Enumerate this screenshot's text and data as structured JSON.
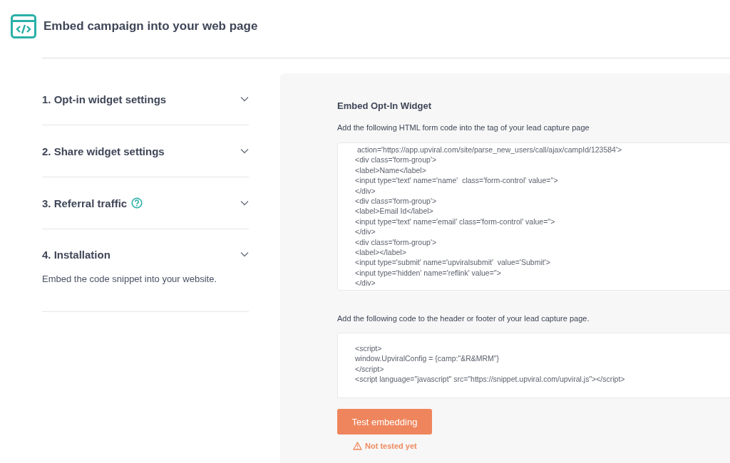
{
  "header": {
    "title": "Embed campaign into your web page"
  },
  "sections": [
    {
      "label": "1. Opt-in widget settings",
      "help": false,
      "expanded": false
    },
    {
      "label": "2. Share widget settings",
      "help": false,
      "expanded": false
    },
    {
      "label": "3. Referral traffic",
      "help": true,
      "expanded": false
    },
    {
      "label": "4. Installation",
      "help": false,
      "expanded": true,
      "description": "Embed the code snippet into your website."
    }
  ],
  "panel": {
    "title": "Embed Opt-In Widget",
    "form_hint": "Add the following HTML form code into the tag of your lead capture page",
    "form_code": [
      " action='https://app.upviral.com/site/parse_new_users/call/ajax/campId/123584'>",
      "<div class='form-group'>",
      "<label>Name</label>",
      "<input type='text' name='name'  class='form-control' value=''>",
      "</div>",
      "<div class='form-group'>",
      "<label>Email Id</label>",
      "<input type='text' name='email' class='form-control' value=''>",
      "</div>",
      "<div class='form-group'>",
      "<label></label>",
      "<input type='submit' name='upviralsubmit'  value='Submit'>",
      "<input type='hidden' name='reflink' value=''>",
      "</div>"
    ],
    "script_hint": "Add the following code to the header or footer of your lead capture page.",
    "script_code": [
      "<script>",
      "window.UpviralConfig = {camp:\"&R&MRM\"}",
      "</script>",
      "<script language=\"javascript\" src=\"https://snippet.upviral.com/upviral.js\"></script>"
    ],
    "button": "Test embedding",
    "status": "Not tested yet"
  }
}
